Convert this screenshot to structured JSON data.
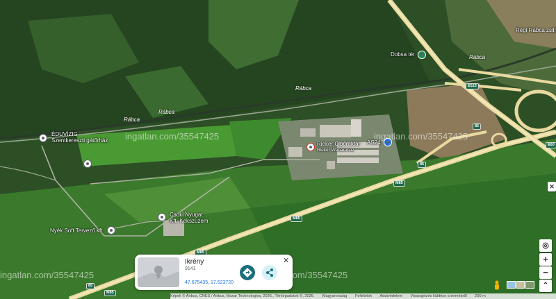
{
  "place_labels": {
    "eduvizig_1": "ÉDUVÍZIG",
    "eduvizig_2": "Szentkereszti gátőrház",
    "regi_rabca": "Régi Rábca zsilip",
    "dobsa_ter": "Dobsa tér",
    "rieker_1": "Rieker Cipőraktár",
    "rieker_2": "Rieker Webáruház",
    "as24": "AS24",
    "csoki_1": "Csoki Nyugat",
    "csoki_2": "Kft. Kekszüzem",
    "nyek": "Nyék Soft Tervező kft"
  },
  "river_labels": {
    "r1": "Rábca",
    "r2": "Rábca",
    "r3": "Rábca",
    "r4": "Rábca"
  },
  "road_shields": {
    "m85_a": "M85",
    "m85_b": "M85",
    "m85_c": "M85",
    "r85_a": "85",
    "r85_b": "85",
    "e60": "E60",
    "e523": "E523"
  },
  "watermarks": {
    "wm1": "ingatlan.com/35547425",
    "wm2": "ingatlan.com/35547425",
    "wm3": "ingatlan.com/35547425",
    "wm4": "ingatlan.com/35547425"
  },
  "place_card": {
    "title": "Ikrény",
    "postcode": "9141",
    "coordinates": "47.675435, 17.523720",
    "close_icon": "close-icon",
    "directions_icon": "directions-icon",
    "share_icon": "share-icon"
  },
  "controls": {
    "zoom_in": "+",
    "zoom_out": "−",
    "scale": "200 m"
  },
  "attribution": {
    "imagery": "Képek © Airbus, CNES / Airbus, Maxar Technologies, 2026., Térképadatok ©, 2026.",
    "country": "Magyarország",
    "terms": "Feltételek",
    "privacy": "Adatvédelem",
    "feedback": "Visszajelzés küldése a termékről"
  },
  "colors": {
    "forest": "#284a21",
    "field": "#3a7a2a",
    "road": "#e8d9a0",
    "accent_teal": "#1b6f7c"
  }
}
